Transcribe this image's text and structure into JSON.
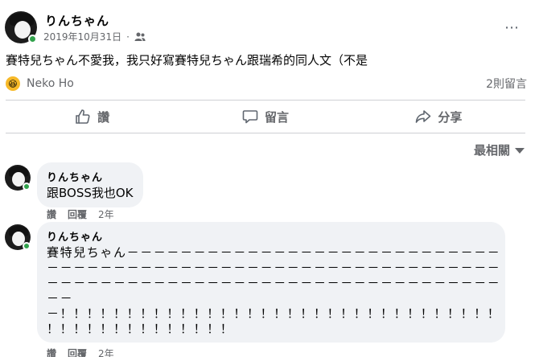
{
  "post": {
    "author": "りんちゃん",
    "date": "2019年10月31日",
    "separator": "·",
    "audience_icon": "friends-icon",
    "more_icon": "⋯",
    "text": "賽特兒ちゃん不愛我，我只好寫賽特兒ちゃん跟瑞希的同人文（不是",
    "reaction": {
      "emoji": "😆",
      "name": "Neko Ho"
    },
    "comment_count": "2則留言"
  },
  "actions": {
    "like": "讚",
    "comment": "留言",
    "share": "分享"
  },
  "sort_label": "最相關",
  "comments": [
    {
      "author": "りんちゃん",
      "text": "跟BOSS我也OK",
      "like": "讚",
      "reply": "回覆",
      "time": "2年"
    },
    {
      "author": "りんちゃん",
      "lines": [
        "賽特兒ちゃん－－－－－－－－－－－－－－－－－－－－－－－－－－－－",
        "－－－－－－－－－－－－－－－－－－－－－－－－－－－－－－－－－－",
        "－－－－－－－－－－－－－－－－－－－－－－－－－－－－－－－－－－",
        "－－",
        "－！！！！！！！！！！！！！！！！！！！！！！！！！！！！！！！！！",
        "！！！！！！！！！！！！！！"
      ],
      "like": "讚",
      "reply": "回覆",
      "time": "2年"
    }
  ]
}
